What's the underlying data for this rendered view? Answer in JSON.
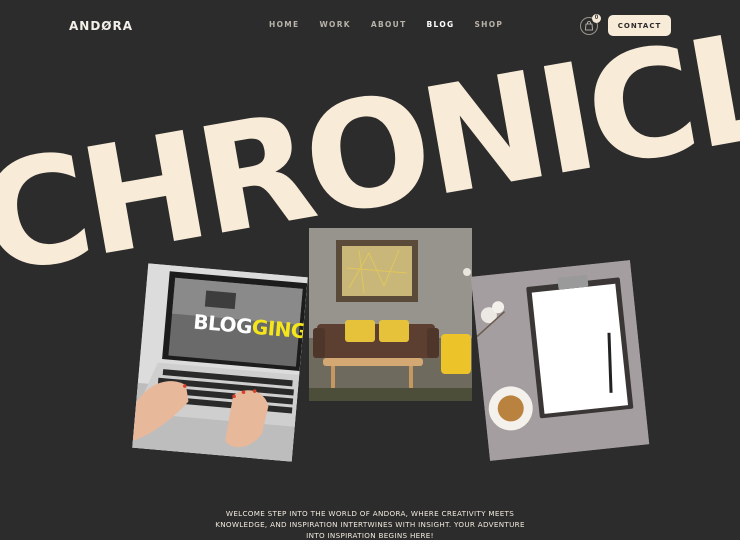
{
  "brand": {
    "logo": "ANDØRA"
  },
  "nav": {
    "items": [
      {
        "label": "HOME"
      },
      {
        "label": "WORK"
      },
      {
        "label": "ABOUT"
      },
      {
        "label": "BLOG"
      },
      {
        "label": "SHOP"
      }
    ],
    "active": "BLOG"
  },
  "cart": {
    "count": "0",
    "icon": "shopping-bag-icon"
  },
  "contact": {
    "label": "CONTACT"
  },
  "hero": {
    "headline": "CHRONICLES",
    "laptop_screen_text_1": "BLOG",
    "laptop_screen_text_2": "GING",
    "intro": "WELCOME STEP INTO THE WORLD OF ANDORA, WHERE CREATIVITY MEETS KNOWLEDGE, AND INSPIRATION INTERTWINES WITH INSIGHT. YOUR ADVENTURE INTO INSPIRATION BEGINS HERE!"
  },
  "colors": {
    "background": "#2c2c2c",
    "headline": "#f8ebd8",
    "accent": "#f8ebd8"
  }
}
